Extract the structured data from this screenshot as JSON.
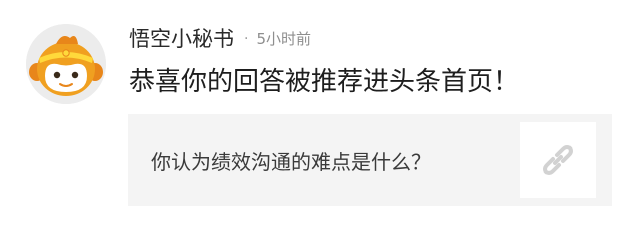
{
  "notification": {
    "sender_name": "悟空小秘书",
    "separator": "·",
    "time_ago": "5小时前",
    "message": "恭喜你的回答被推荐进头条首页！",
    "quote": {
      "question": "你认为绩效沟通的难点是什么？",
      "icon": "link-icon"
    },
    "avatar_icon": "monkey-avatar-icon"
  },
  "colors": {
    "avatar_orange": "#f0a020",
    "avatar_orange_dark": "#e8861a",
    "avatar_face": "#ffffff",
    "avatar_headband": "#ffd93b",
    "card_background": "#f4f4f4",
    "link_icon": "#d2d2d2"
  }
}
